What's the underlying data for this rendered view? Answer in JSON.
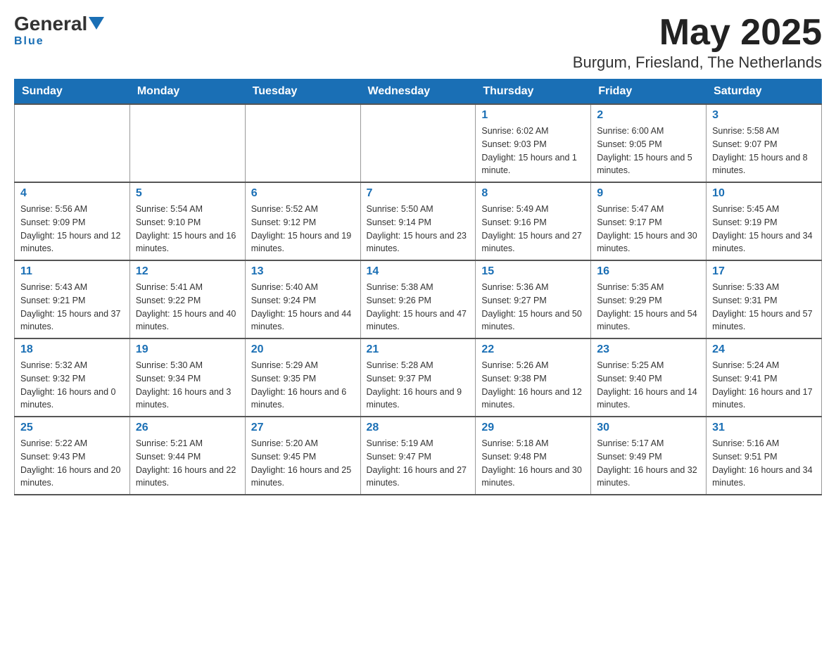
{
  "header": {
    "logo_general": "General",
    "logo_blue": "Blue",
    "month_year": "May 2025",
    "location": "Burgum, Friesland, The Netherlands"
  },
  "days_of_week": [
    "Sunday",
    "Monday",
    "Tuesday",
    "Wednesday",
    "Thursday",
    "Friday",
    "Saturday"
  ],
  "weeks": [
    [
      {
        "day": "",
        "info": ""
      },
      {
        "day": "",
        "info": ""
      },
      {
        "day": "",
        "info": ""
      },
      {
        "day": "",
        "info": ""
      },
      {
        "day": "1",
        "info": "Sunrise: 6:02 AM\nSunset: 9:03 PM\nDaylight: 15 hours and 1 minute."
      },
      {
        "day": "2",
        "info": "Sunrise: 6:00 AM\nSunset: 9:05 PM\nDaylight: 15 hours and 5 minutes."
      },
      {
        "day": "3",
        "info": "Sunrise: 5:58 AM\nSunset: 9:07 PM\nDaylight: 15 hours and 8 minutes."
      }
    ],
    [
      {
        "day": "4",
        "info": "Sunrise: 5:56 AM\nSunset: 9:09 PM\nDaylight: 15 hours and 12 minutes."
      },
      {
        "day": "5",
        "info": "Sunrise: 5:54 AM\nSunset: 9:10 PM\nDaylight: 15 hours and 16 minutes."
      },
      {
        "day": "6",
        "info": "Sunrise: 5:52 AM\nSunset: 9:12 PM\nDaylight: 15 hours and 19 minutes."
      },
      {
        "day": "7",
        "info": "Sunrise: 5:50 AM\nSunset: 9:14 PM\nDaylight: 15 hours and 23 minutes."
      },
      {
        "day": "8",
        "info": "Sunrise: 5:49 AM\nSunset: 9:16 PM\nDaylight: 15 hours and 27 minutes."
      },
      {
        "day": "9",
        "info": "Sunrise: 5:47 AM\nSunset: 9:17 PM\nDaylight: 15 hours and 30 minutes."
      },
      {
        "day": "10",
        "info": "Sunrise: 5:45 AM\nSunset: 9:19 PM\nDaylight: 15 hours and 34 minutes."
      }
    ],
    [
      {
        "day": "11",
        "info": "Sunrise: 5:43 AM\nSunset: 9:21 PM\nDaylight: 15 hours and 37 minutes."
      },
      {
        "day": "12",
        "info": "Sunrise: 5:41 AM\nSunset: 9:22 PM\nDaylight: 15 hours and 40 minutes."
      },
      {
        "day": "13",
        "info": "Sunrise: 5:40 AM\nSunset: 9:24 PM\nDaylight: 15 hours and 44 minutes."
      },
      {
        "day": "14",
        "info": "Sunrise: 5:38 AM\nSunset: 9:26 PM\nDaylight: 15 hours and 47 minutes."
      },
      {
        "day": "15",
        "info": "Sunrise: 5:36 AM\nSunset: 9:27 PM\nDaylight: 15 hours and 50 minutes."
      },
      {
        "day": "16",
        "info": "Sunrise: 5:35 AM\nSunset: 9:29 PM\nDaylight: 15 hours and 54 minutes."
      },
      {
        "day": "17",
        "info": "Sunrise: 5:33 AM\nSunset: 9:31 PM\nDaylight: 15 hours and 57 minutes."
      }
    ],
    [
      {
        "day": "18",
        "info": "Sunrise: 5:32 AM\nSunset: 9:32 PM\nDaylight: 16 hours and 0 minutes."
      },
      {
        "day": "19",
        "info": "Sunrise: 5:30 AM\nSunset: 9:34 PM\nDaylight: 16 hours and 3 minutes."
      },
      {
        "day": "20",
        "info": "Sunrise: 5:29 AM\nSunset: 9:35 PM\nDaylight: 16 hours and 6 minutes."
      },
      {
        "day": "21",
        "info": "Sunrise: 5:28 AM\nSunset: 9:37 PM\nDaylight: 16 hours and 9 minutes."
      },
      {
        "day": "22",
        "info": "Sunrise: 5:26 AM\nSunset: 9:38 PM\nDaylight: 16 hours and 12 minutes."
      },
      {
        "day": "23",
        "info": "Sunrise: 5:25 AM\nSunset: 9:40 PM\nDaylight: 16 hours and 14 minutes."
      },
      {
        "day": "24",
        "info": "Sunrise: 5:24 AM\nSunset: 9:41 PM\nDaylight: 16 hours and 17 minutes."
      }
    ],
    [
      {
        "day": "25",
        "info": "Sunrise: 5:22 AM\nSunset: 9:43 PM\nDaylight: 16 hours and 20 minutes."
      },
      {
        "day": "26",
        "info": "Sunrise: 5:21 AM\nSunset: 9:44 PM\nDaylight: 16 hours and 22 minutes."
      },
      {
        "day": "27",
        "info": "Sunrise: 5:20 AM\nSunset: 9:45 PM\nDaylight: 16 hours and 25 minutes."
      },
      {
        "day": "28",
        "info": "Sunrise: 5:19 AM\nSunset: 9:47 PM\nDaylight: 16 hours and 27 minutes."
      },
      {
        "day": "29",
        "info": "Sunrise: 5:18 AM\nSunset: 9:48 PM\nDaylight: 16 hours and 30 minutes."
      },
      {
        "day": "30",
        "info": "Sunrise: 5:17 AM\nSunset: 9:49 PM\nDaylight: 16 hours and 32 minutes."
      },
      {
        "day": "31",
        "info": "Sunrise: 5:16 AM\nSunset: 9:51 PM\nDaylight: 16 hours and 34 minutes."
      }
    ]
  ]
}
